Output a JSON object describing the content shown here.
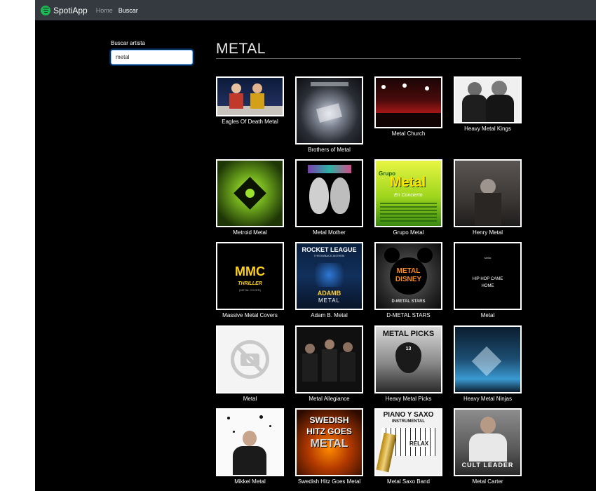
{
  "app": {
    "brand": "SpotiApp",
    "nav": [
      "Home",
      "Buscar"
    ]
  },
  "search": {
    "label": "Buscar artista",
    "value": "metal"
  },
  "results": {
    "title": "METAL",
    "artists": [
      {
        "name": "Eagles Of Death Metal"
      },
      {
        "name": "Brothers of Metal"
      },
      {
        "name": "Metal Church"
      },
      {
        "name": "Heavy Metal Kings"
      },
      {
        "name": "Metroid Metal"
      },
      {
        "name": "Metal Mother"
      },
      {
        "name": "Grupo Metal",
        "art_text": [
          "Grupo",
          "Metal",
          "En Concierto"
        ]
      },
      {
        "name": "Henry Metal"
      },
      {
        "name": "Massive Metal Covers",
        "art_text": [
          "MMC",
          "THRILLER",
          "(METAL COVER)"
        ]
      },
      {
        "name": "Adam B. Metal",
        "art_text": [
          "ROCKET LEAGUE",
          "THROWBACK ANTHEM",
          "ADAMB",
          "METAL"
        ]
      },
      {
        "name": "D-METAL STARS",
        "art_text": [
          "METAL",
          "DISNEY",
          "D-METAL STARS"
        ]
      },
      {
        "name": "Metal",
        "art_text": [
          "Metal",
          "HIP HOP CAME",
          "HOME"
        ]
      },
      {
        "name": "Metal"
      },
      {
        "name": "Metal Allegiance"
      },
      {
        "name": "Heavy Metal Picks",
        "art_text": [
          "METAL PICKS",
          "13"
        ]
      },
      {
        "name": "Heavy Metal Ninjas"
      },
      {
        "name": "Mikkel Metal"
      },
      {
        "name": "Swedish Hitz Goes Metal",
        "art_text": [
          "SWEDISH",
          "HITZ GOES",
          "METAL"
        ]
      },
      {
        "name": "Metal Saxo Band",
        "art_text": [
          "PIANO Y SAXO",
          "INSTRUMENTAL",
          "RELAX"
        ]
      },
      {
        "name": "Metal Carter",
        "art_text": [
          "CULT LEADER"
        ]
      }
    ]
  }
}
